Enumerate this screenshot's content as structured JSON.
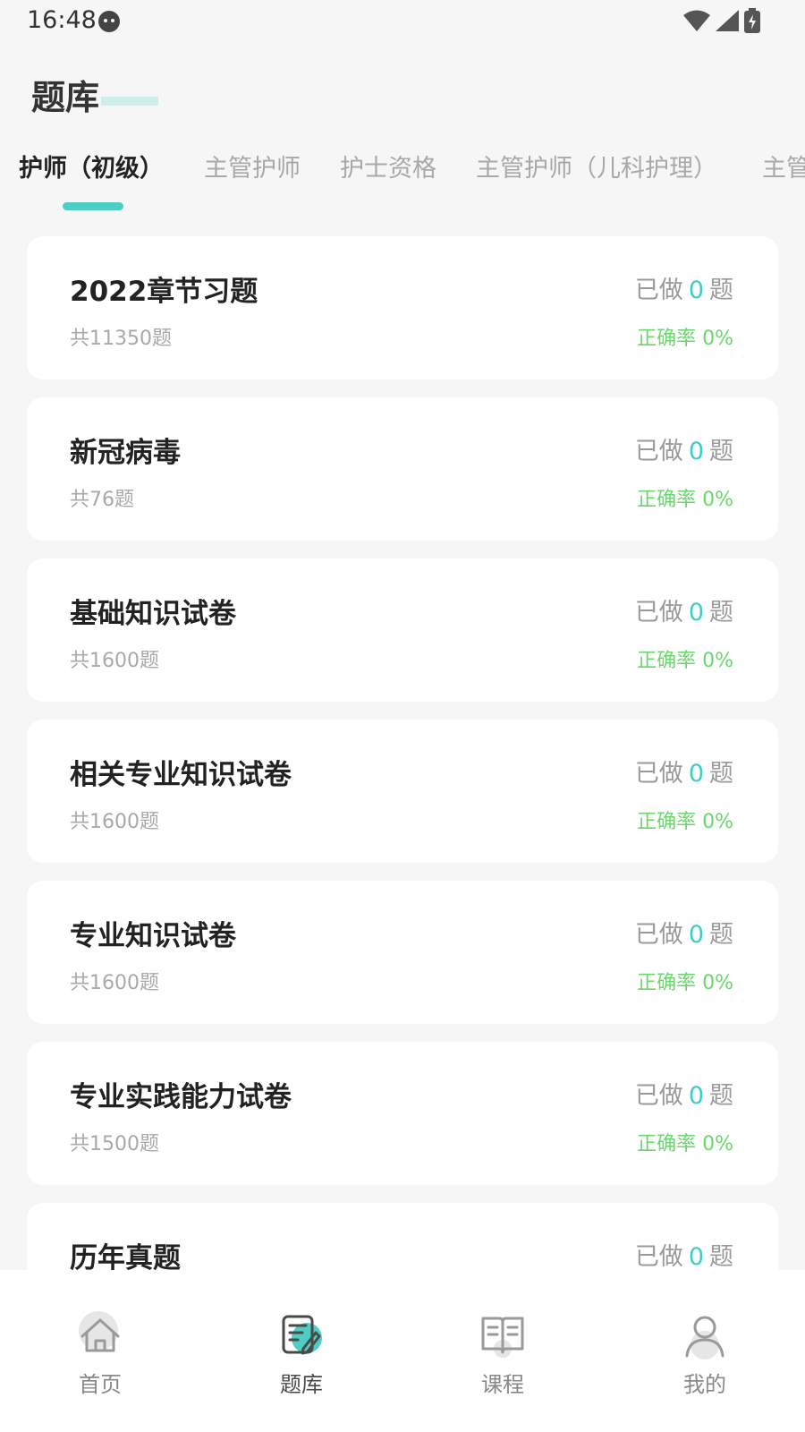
{
  "status_bar": {
    "time": "16:48"
  },
  "page_title": "题库",
  "tabs": [
    {
      "label": "护师（初级）",
      "active": true
    },
    {
      "label": "主管护师",
      "active": false
    },
    {
      "label": "护士资格",
      "active": false
    },
    {
      "label": "主管护师（儿科护理）",
      "active": false
    },
    {
      "label": "主管",
      "active": false
    }
  ],
  "cards": [
    {
      "title": "2022章节习题",
      "count": "共11350题",
      "done_prefix": "已做",
      "done_value": "0",
      "done_suffix": "题",
      "accuracy": "正确率 0%"
    },
    {
      "title": "新冠病毒",
      "count": "共76题",
      "done_prefix": "已做",
      "done_value": "0",
      "done_suffix": "题",
      "accuracy": "正确率 0%"
    },
    {
      "title": "基础知识试卷",
      "count": "共1600题",
      "done_prefix": "已做",
      "done_value": "0",
      "done_suffix": "题",
      "accuracy": "正确率 0%"
    },
    {
      "title": "相关专业知识试卷",
      "count": "共1600题",
      "done_prefix": "已做",
      "done_value": "0",
      "done_suffix": "题",
      "accuracy": "正确率 0%"
    },
    {
      "title": "专业知识试卷",
      "count": "共1600题",
      "done_prefix": "已做",
      "done_value": "0",
      "done_suffix": "题",
      "accuracy": "正确率 0%"
    },
    {
      "title": "专业实践能力试卷",
      "count": "共1500题",
      "done_prefix": "已做",
      "done_value": "0",
      "done_suffix": "题",
      "accuracy": "正确率 0%"
    },
    {
      "title": "历年真题",
      "count": "",
      "done_prefix": "已做",
      "done_value": "0",
      "done_suffix": "题",
      "accuracy": ""
    }
  ],
  "bottom_nav": [
    {
      "label": "首页",
      "icon": "home-icon",
      "active": false
    },
    {
      "label": "题库",
      "icon": "question-bank-icon",
      "active": true
    },
    {
      "label": "课程",
      "icon": "book-icon",
      "active": false
    },
    {
      "label": "我的",
      "icon": "user-icon",
      "active": false
    }
  ],
  "colors": {
    "accent": "#4ecdc4",
    "accuracy": "#69d86b",
    "background": "#f6f6f6"
  }
}
